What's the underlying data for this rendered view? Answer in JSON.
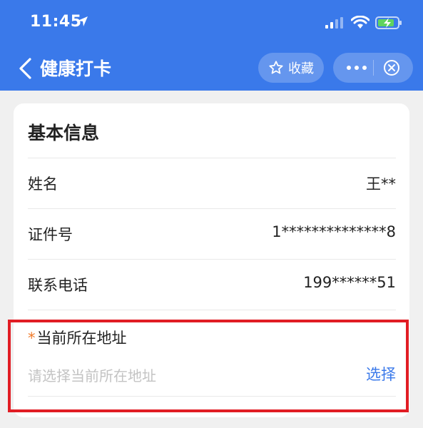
{
  "status_bar": {
    "time": "11:45"
  },
  "nav": {
    "title": "健康打卡",
    "favorite_label": "收藏"
  },
  "card": {
    "title": "基本信息",
    "rows": [
      {
        "label": "姓名",
        "value": "王**"
      },
      {
        "label": "证件号",
        "value": "1**************8"
      },
      {
        "label": "联系电话",
        "value": "199******51"
      }
    ],
    "address": {
      "required_mark": "*",
      "label": "当前所在地址",
      "placeholder": "请选择当前所在地址",
      "select_label": "选择"
    }
  },
  "colors": {
    "header_bg": "#3a79ea",
    "link": "#3a79ea",
    "required": "#f07b2b",
    "highlight": "#e11d24"
  },
  "icons": [
    "location-arrow-icon",
    "signal-icon",
    "wifi-icon",
    "battery-charging-icon",
    "back-icon",
    "star-icon",
    "more-icon",
    "close-circle-icon"
  ]
}
